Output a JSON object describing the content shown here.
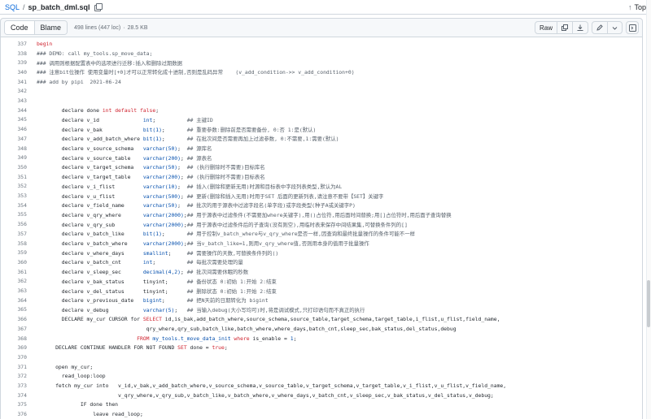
{
  "breadcrumb": {
    "parent": "SQL",
    "separator": "/",
    "file": "sp_batch_dml.sql"
  },
  "top_link": "Top",
  "tabs": [
    {
      "label": "Code"
    },
    {
      "label": "Blame"
    }
  ],
  "meta": {
    "lines": "498 lines (447 loc)",
    "dot": "·",
    "size": "28.5 KB"
  },
  "toolbar": {
    "raw_label": "Raw"
  },
  "code_lines": [
    {
      "n": "337",
      "t": [
        [
          "kw",
          "begin"
        ]
      ]
    },
    {
      "n": "338",
      "t": [
        [
          "cm",
          "### DEMO: call my_tools.sp_move_data;"
        ]
      ]
    },
    {
      "n": "339",
      "t": [
        [
          "cm",
          "### 调用则根据配置表中的选项进行迁移:插入和删除过期数据"
        ]
      ]
    },
    {
      "n": "340",
      "t": [
        [
          "cm",
          "### 注意bit位操作 使用变量时[+0]才可以正常转化成十进制,否则是乱码异常    (v_add_condition->> v_add_condition+0)"
        ]
      ]
    },
    {
      "n": "341",
      "t": [
        [
          "cm",
          "### add by pipi  2021-06-24"
        ]
      ]
    },
    {
      "n": "342",
      "t": [
        [
          "",
          ""
        ]
      ]
    },
    {
      "n": "343",
      "t": [
        [
          "",
          ""
        ]
      ]
    },
    {
      "n": "344",
      "t": [
        [
          "",
          "        declare done "
        ],
        [
          "kw",
          "int"
        ],
        [
          "kw",
          " default"
        ],
        [
          "",
          " "
        ],
        [
          "kw",
          "false"
        ],
        [
          "",
          ";"
        ]
      ]
    },
    {
      "n": "345",
      "t": [
        [
          "",
          "        declare v_id              "
        ],
        [
          "ty",
          "int"
        ],
        [
          "",
          ";          "
        ],
        [
          "cm",
          "## 主键ID"
        ]
      ]
    },
    {
      "n": "346",
      "t": [
        [
          "",
          "        declare v_bak             "
        ],
        [
          "ty",
          "bit(1)"
        ],
        [
          "",
          ";       "
        ],
        [
          "cm",
          "## 重要参数:删除前是否需要备份, 0:否 1:是(默认)"
        ]
      ]
    },
    {
      "n": "347",
      "t": [
        [
          "",
          "        declare v_add_batch_where "
        ],
        [
          "ty",
          "bit(1)"
        ],
        [
          "",
          ";       "
        ],
        [
          "cm",
          "## 在批次间是否需要再加上过滤参数, 0:不需要,1:需要(默认)"
        ]
      ]
    },
    {
      "n": "348",
      "t": [
        [
          "",
          "        declare v_source_schema   "
        ],
        [
          "ty",
          "varchar(50)"
        ],
        [
          "",
          ";  "
        ],
        [
          "cm",
          "## 源库名"
        ]
      ]
    },
    {
      "n": "349",
      "t": [
        [
          "",
          "        declare v_source_table    "
        ],
        [
          "ty",
          "varchar(200)"
        ],
        [
          "",
          "; "
        ],
        [
          "cm",
          "## 源表名"
        ]
      ]
    },
    {
      "n": "350",
      "t": [
        [
          "",
          "        declare v_target_schema   "
        ],
        [
          "ty",
          "varchar(50)"
        ],
        [
          "",
          ";  "
        ],
        [
          "cm",
          "## (执行删除时不需要)目标库名"
        ]
      ]
    },
    {
      "n": "351",
      "t": [
        [
          "",
          "        declare v_target_table    "
        ],
        [
          "ty",
          "varchar(200)"
        ],
        [
          "",
          "; "
        ],
        [
          "cm",
          "## (执行删除时不需要)目标表名"
        ]
      ]
    },
    {
      "n": "352",
      "t": [
        [
          "",
          "        declare v_i_flist         "
        ],
        [
          "ty",
          "varchar(10)"
        ],
        [
          "",
          ";  "
        ],
        [
          "cm",
          "## 插入(删除和更新无用)时源和目标表中字段列表类型,默认为AL"
        ]
      ]
    },
    {
      "n": "353",
      "t": [
        [
          "",
          "        declare v_u_flist         "
        ],
        [
          "ty",
          "varchar(500)"
        ],
        [
          "",
          "; "
        ],
        [
          "cm",
          "## 更新(删除和插入无用)时用于SET 后面的更新列表,请注意不要带【SET】关键字"
        ]
      ]
    },
    {
      "n": "354",
      "t": [
        [
          "",
          "        declare v_field_name      "
        ],
        [
          "ty",
          "varchar(50)"
        ],
        [
          "",
          ";  "
        ],
        [
          "cm",
          "## 批次的用于源表中过滤字段名(单字段)或字段类型(种子A或关键字P)"
        ]
      ]
    },
    {
      "n": "355",
      "t": [
        [
          "",
          "        declare v_qry_where       "
        ],
        [
          "ty",
          "varchar(2000)"
        ],
        [
          "",
          ";"
        ],
        [
          "cm",
          "## 用于源表中过滤条件(不需要加where关键字),用()占位符,用后面时间替换;用[]占位符时,用后面子查询替换"
        ]
      ]
    },
    {
      "n": "356",
      "t": [
        [
          "",
          "        declare v_qry_sub         "
        ],
        [
          "ty",
          "varchar(2000)"
        ],
        [
          "",
          ";"
        ],
        [
          "cm",
          "## 用于源表中过滤条件后的子查询(没有则空),用临时表来保存中间结果集,可替换条件列的[]"
        ]
      ]
    },
    {
      "n": "357",
      "t": [
        [
          "",
          "        declare v_batch_like      "
        ],
        [
          "ty",
          "bit(1)"
        ],
        [
          "",
          ";       "
        ],
        [
          "cm",
          "## 用于控制v_batch_where与v_qry_where是否一样,因查询和最终批量操作的条件可能不一样"
        ]
      ]
    },
    {
      "n": "358",
      "t": [
        [
          "",
          "        declare v_batch_where     "
        ],
        [
          "ty",
          "varchar(2000)"
        ],
        [
          "",
          ";"
        ],
        [
          "cm",
          "## 当v_batch_like=1,则用v_qry_where值,否则用本身的值用于批量操作"
        ]
      ]
    },
    {
      "n": "359",
      "t": [
        [
          "",
          "        declare v_where_days      "
        ],
        [
          "ty",
          "smallint"
        ],
        [
          "",
          ";     "
        ],
        [
          "cm",
          "## 需要操作的天数,可替换条件列的()"
        ]
      ]
    },
    {
      "n": "360",
      "t": [
        [
          "",
          "        declare v_batch_cnt       "
        ],
        [
          "ty",
          "int"
        ],
        [
          "",
          ";          "
        ],
        [
          "cm",
          "## 每批次需要处理的量"
        ]
      ]
    },
    {
      "n": "361",
      "t": [
        [
          "",
          "        declare v_sleep_sec       "
        ],
        [
          "ty",
          "decimal(4,2)"
        ],
        [
          "",
          "; "
        ],
        [
          "cm",
          "## 批次间需要休眠的秒数"
        ]
      ]
    },
    {
      "n": "362",
      "t": [
        [
          "",
          "        declare v_bak_status      "
        ],
        [
          "",
          "tinyint"
        ],
        [
          "",
          ";      "
        ],
        [
          "cm",
          "## 备份状态 0:初始 1:开始 2:结束"
        ]
      ]
    },
    {
      "n": "363",
      "t": [
        [
          "",
          "        declare v_del_status      "
        ],
        [
          "",
          "tinyint"
        ],
        [
          "",
          ";      "
        ],
        [
          "cm",
          "## 删除状态 0:初始 1:开始 2:结束"
        ]
      ]
    },
    {
      "n": "364",
      "t": [
        [
          "",
          "        declare v_previous_date   "
        ],
        [
          "ty",
          "bigint"
        ],
        [
          "",
          ";       "
        ],
        [
          "cm",
          "## 把N天前的日期转化为 bigint"
        ]
      ]
    },
    {
      "n": "365",
      "t": [
        [
          "",
          "        declare v_debug           "
        ],
        [
          "ty",
          "varchar(5)"
        ],
        [
          "",
          ";   "
        ],
        [
          "cm",
          "## 当输入debug(大小写均可)时,将是调试模式,只打印语句而不真正的执行"
        ]
      ]
    },
    {
      "n": "366",
      "t": [
        [
          "",
          "        DECLARE my_cur CURSOR for "
        ],
        [
          "kw",
          "SELECT"
        ],
        [
          "",
          " id,is_bak,add_batch_where,source_schema,source_table,target_schema,target_table,i_flist,u_flist,field_name,"
        ]
      ]
    },
    {
      "n": "367",
      "t": [
        [
          "",
          "                                   qry_where,qry_sub,batch_like,batch_where,where_days,batch_cnt,sleep_sec,bak_status,del_status,debug"
        ]
      ]
    },
    {
      "n": "368",
      "t": [
        [
          "",
          "                                "
        ],
        [
          "kw",
          "FROM"
        ],
        [
          "",
          " "
        ],
        [
          "ty",
          "my_tools.t_move_data_init"
        ],
        [
          "",
          " "
        ],
        [
          "kw",
          "where"
        ],
        [
          "",
          " is_enable = "
        ],
        [
          "ty",
          "1"
        ],
        [
          "",
          ";"
        ]
      ]
    },
    {
      "n": "369",
      "t": [
        [
          "",
          "      DECLARE CONTINUE HANDLER FOR NOT FOUND "
        ],
        [
          "kw",
          "SET"
        ],
        [
          "",
          " done = "
        ],
        [
          "kw",
          "true"
        ],
        [
          "",
          ";"
        ]
      ]
    },
    {
      "n": "370",
      "t": [
        [
          "",
          ""
        ]
      ]
    },
    {
      "n": "371",
      "t": [
        [
          "",
          "      open my_cur;"
        ]
      ]
    },
    {
      "n": "372",
      "t": [
        [
          "",
          "        read_loop:loop"
        ]
      ]
    },
    {
      "n": "373",
      "t": [
        [
          "",
          "      fetch my_cur into   v_id,v_bak,v_add_batch_where,v_source_schema,v_source_table,v_target_schema,v_target_table,v_i_flist,v_u_flist,v_field_name,"
        ]
      ]
    },
    {
      "n": "374",
      "t": [
        [
          "",
          "                          v_qry_where,v_qry_sub,v_batch_like,v_batch_where,v_where_days,v_batch_cnt,v_sleep_sec,v_bak_status,v_del_status,v_debug;"
        ]
      ]
    },
    {
      "n": "375",
      "t": [
        [
          "",
          "              IF done then"
        ]
      ]
    },
    {
      "n": "376",
      "t": [
        [
          "",
          "                  leave read_loop;"
        ]
      ]
    }
  ]
}
